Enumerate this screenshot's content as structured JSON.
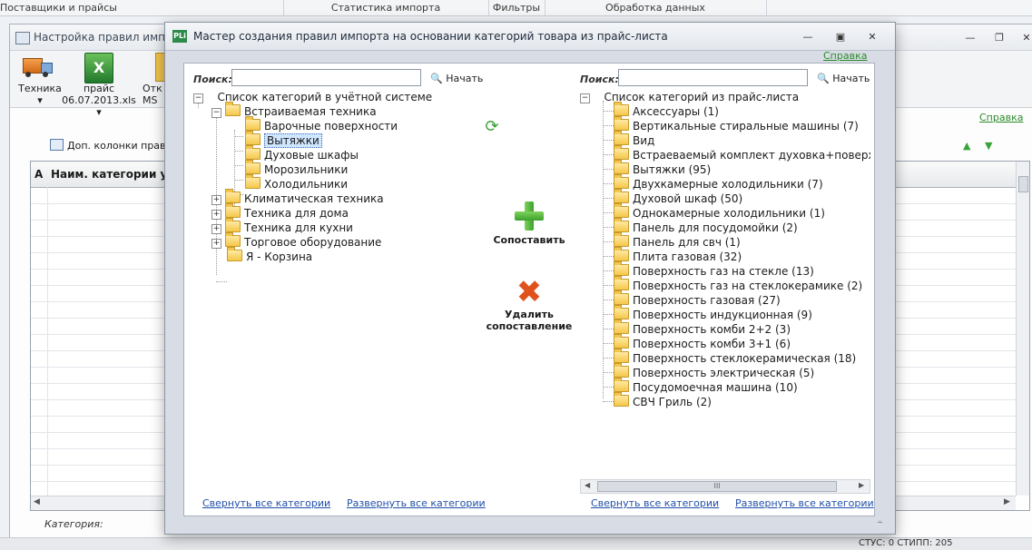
{
  "topbar": {
    "tabs": [
      "Поставщики и прайсы",
      "Статистика импорта",
      "Фильтры",
      "Обработка данных"
    ]
  },
  "bgwindow": {
    "title": "Настройка правил импор",
    "ribbon": {
      "btn1": "Техника",
      "btn2_top": "прайс",
      "btn2_bottom": "06.07.2013.xls",
      "btn3_top": "Отк",
      "btn3_bottom": "MS"
    },
    "help": "Справка",
    "extra_columns": "Доп. колонки правил",
    "grid_headers": [
      "А",
      "Наим. категории уч."
    ],
    "category_label": "Категория:"
  },
  "status": "СТУС: 0  СТИПП: 205",
  "dialog": {
    "title": "Мастер создания правил импорта на основании категорий товара из прайс-листа",
    "help": "Справка",
    "search_label": "Поиск:",
    "search_button": "Начать",
    "left_search_value": "",
    "right_search_value": "",
    "left_tree": {
      "root": "Список категорий в учётной системе",
      "groups": [
        {
          "label": "Встраиваемая техника",
          "children": [
            "Варочные поверхности",
            "Вытяжки",
            "Духовые шкафы",
            "Морозильники",
            "Холодильники"
          ]
        },
        {
          "label": "Климатическая техника"
        },
        {
          "label": "Техника для дома"
        },
        {
          "label": "Техника для кухни"
        },
        {
          "label": "Торговое оборудование"
        },
        {
          "label": "Я - Корзина"
        }
      ]
    },
    "right_tree": {
      "root": "Список категорий из прайс-листа",
      "items": [
        "Аксессуары (1)",
        "Вертикальные стиральные машины (7)",
        "Вид",
        "Встраеваемый комплект духовка+поверхност",
        "Вытяжки (95)",
        "Двухкамерные холодильники (7)",
        "Духовой шкаф (50)",
        "Однокамерные холодильники (1)",
        "Панель для посудомойки (2)",
        "Панель для свч (1)",
        "Плита газовая (32)",
        "Поверхность газ на стекле (13)",
        "Поверхность газ на стеклокерамике (2)",
        "Поверхность газовая (27)",
        "Поверхность индукционная (9)",
        "Поверхность комби 2+2 (3)",
        "Поверхность комби 3+1 (6)",
        "Поверхность стеклокерамическая (18)",
        "Поверхность электрическая (5)",
        "Посудомоечная машина (10)",
        "СВЧ Гриль (2)"
      ]
    },
    "match_button": "Сопоставить",
    "delete_button_l1": "Удалить",
    "delete_button_l2": "сопоставление",
    "collapse_all": "Свернуть все категории",
    "expand_all": "Развернуть все категории",
    "scroll_thumb": "III"
  }
}
